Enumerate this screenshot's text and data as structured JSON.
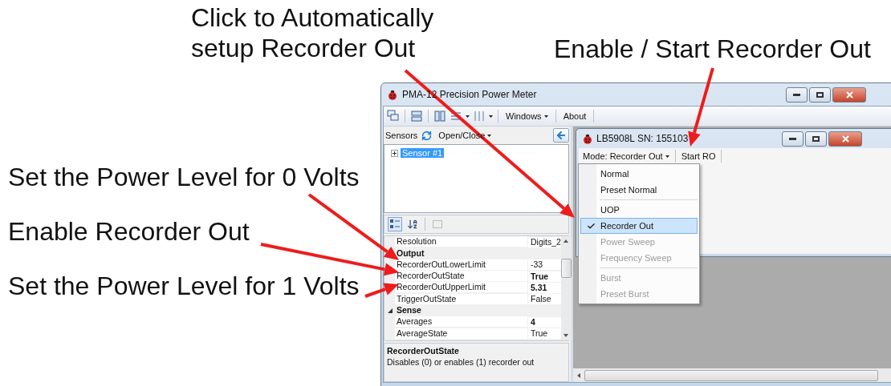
{
  "annotations": [
    {
      "text": "Click to Automatically\nsetup Recorder Out"
    },
    {
      "text": "Enable / Start Recorder Out"
    },
    {
      "text": "Set the Power Level for 0 Volts"
    },
    {
      "text": "Enable Recorder Out"
    },
    {
      "text": "Set the Power Level for 1 Volts"
    }
  ],
  "window": {
    "title": "PMA-12 Precision Power Meter",
    "toolbar": [
      {
        "label": "Windows",
        "dropdown": true
      },
      {
        "label": "About",
        "dropdown": false
      }
    ],
    "sensors_bar": {
      "label": "Sensors",
      "menu": "Open/Close"
    },
    "tree": [
      {
        "label": "Sensor #1",
        "selected": true,
        "expanded": false
      }
    ],
    "property_grid": {
      "rows": [
        {
          "kind": "property",
          "name": "Resolution",
          "value": "Digits_2",
          "modified": false
        },
        {
          "kind": "category",
          "name": "Output"
        },
        {
          "kind": "property",
          "name": "RecorderOutLowerLimit",
          "value": "-33",
          "modified": false
        },
        {
          "kind": "property",
          "name": "RecorderOutState",
          "value": "True",
          "modified": true
        },
        {
          "kind": "property",
          "name": "RecorderOutUpperLimit",
          "value": "5.31",
          "modified": true
        },
        {
          "kind": "property",
          "name": "TriggerOutState",
          "value": "False",
          "modified": false
        },
        {
          "kind": "category",
          "name": "Sense",
          "expanded": true
        },
        {
          "kind": "property",
          "name": "Averages",
          "value": "4",
          "modified": true
        },
        {
          "kind": "property",
          "name": "AverageState",
          "value": "True",
          "modified": false
        }
      ],
      "description_title": "RecorderOutState",
      "description": "Disables (0) or enables (1) recorder out"
    },
    "child_window": {
      "title": "LB5908L SN: 155103",
      "mode_button": "Mode: Recorder Out",
      "start_button": "Start RO",
      "menu": [
        {
          "kind": "item",
          "label": "Normal",
          "checked": false,
          "disabled": false
        },
        {
          "kind": "item",
          "label": "Preset Normal",
          "checked": false,
          "disabled": false
        },
        {
          "kind": "separator"
        },
        {
          "kind": "item",
          "label": "UOP",
          "checked": false,
          "disabled": false
        },
        {
          "kind": "item",
          "label": "Recorder Out",
          "checked": true,
          "disabled": false
        },
        {
          "kind": "item",
          "label": "Power Sweep",
          "checked": false,
          "disabled": true
        },
        {
          "kind": "item",
          "label": "Frequency Sweep",
          "checked": false,
          "disabled": true
        },
        {
          "kind": "separator"
        },
        {
          "kind": "item",
          "label": "Burst",
          "checked": false,
          "disabled": true
        },
        {
          "kind": "item",
          "label": "Preset Burst",
          "checked": false,
          "disabled": true
        }
      ]
    }
  }
}
